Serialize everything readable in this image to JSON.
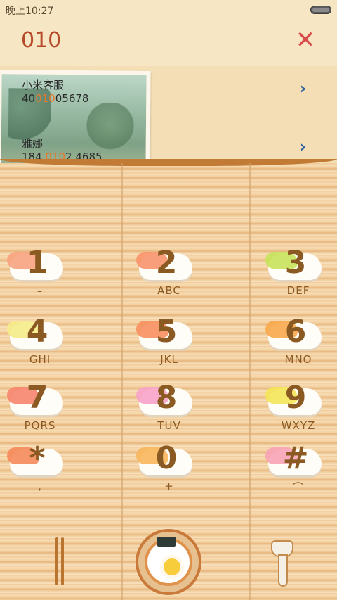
{
  "status_bar": {
    "time": "晚上10:27"
  },
  "dialer": {
    "number": "010",
    "clear_icon": "close-x-icon"
  },
  "results": [
    {
      "name": "小米客服",
      "number_pre": "40",
      "number_hl": "010",
      "number_post": "05678"
    },
    {
      "name": "雅娜",
      "number_pre": "184 ",
      "number_hl": "010",
      "number_post": "2 4685"
    }
  ],
  "keypad": [
    {
      "digit": "1",
      "letters": ""
    },
    {
      "digit": "2",
      "letters": "ABC"
    },
    {
      "digit": "3",
      "letters": "DEF"
    },
    {
      "digit": "4",
      "letters": "GHI"
    },
    {
      "digit": "5",
      "letters": "JKL"
    },
    {
      "digit": "6",
      "letters": "MNO"
    },
    {
      "digit": "7",
      "letters": "PQRS"
    },
    {
      "digit": "8",
      "letters": "TUV"
    },
    {
      "digit": "9",
      "letters": "WXYZ"
    },
    {
      "digit": "*",
      "letters": ","
    },
    {
      "digit": "0",
      "letters": "+"
    },
    {
      "digit": "#",
      "letters": ""
    }
  ],
  "colors": {
    "accent_highlight": "#e8792b",
    "digit_brown": "#8a5a22",
    "clear_red": "#d94a4a",
    "chevron_blue": "#2c5f9e"
  },
  "bottom_bar": {
    "left_icon": "chopsticks-icon",
    "center_icon": "ramen-bowl-call-icon",
    "right_icon": "ladle-icon"
  }
}
